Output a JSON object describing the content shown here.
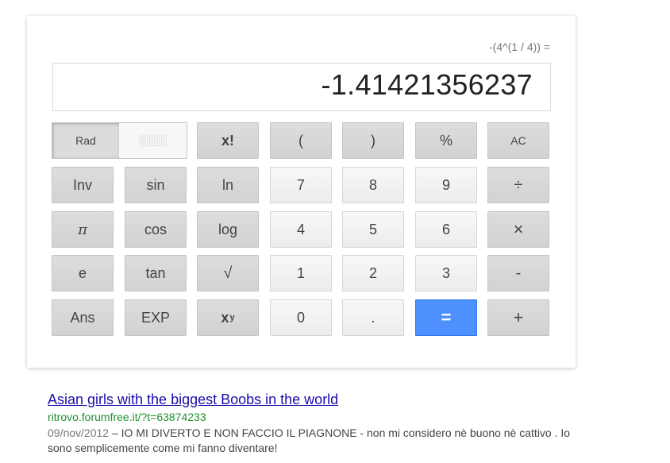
{
  "calculator": {
    "expression": "-(4^(1 / 4)) =",
    "display_value": "-1.41421356237",
    "mode_rad_label": "Rad",
    "buttons": {
      "factorial": "x!",
      "paren_open": "(",
      "paren_close": ")",
      "percent": "%",
      "all_clear": "AC",
      "inv": "Inv",
      "sin": "sin",
      "ln": "ln",
      "seven": "7",
      "eight": "8",
      "nine": "9",
      "divide": "÷",
      "pi": "π",
      "cos": "cos",
      "log": "log",
      "four": "4",
      "five": "5",
      "six": "6",
      "multiply": "×",
      "e": "e",
      "tan": "tan",
      "sqrt": "√",
      "one": "1",
      "two": "2",
      "three": "3",
      "minus": "-",
      "ans": "Ans",
      "exp": "EXP",
      "power_base": "x",
      "power_exp": "y",
      "zero": "0",
      "decimal": ".",
      "equals": "=",
      "plus": "+"
    }
  },
  "result": {
    "title": "Asian girls with the biggest Boobs in the world",
    "url": "ritrovo.forumfree.it/?t=63874233",
    "date": "09/nov/2012",
    "snippet": " – IO MI DIVERTO E NON FACCIO IL PIAGNONE - non mi considero nè buono nè cattivo . Io sono semplicemente come mi fanno diventare!"
  }
}
